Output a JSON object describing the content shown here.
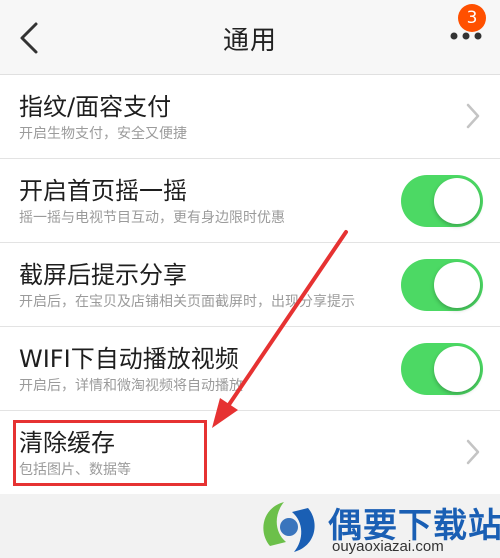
{
  "header": {
    "title": "通用",
    "back_icon": "chevron-left-icon",
    "more_icon": "more-dots-icon",
    "badge_count": "3"
  },
  "settings": [
    {
      "title": "指纹/面容支付",
      "subtitle": "开启生物支付，安全又便捷",
      "control": "chevron"
    },
    {
      "title": "开启首页摇一摇",
      "subtitle": "摇一摇与电视节目互动，更有身边限时优惠",
      "control": "toggle",
      "on": true
    },
    {
      "title": "截屏后提示分享",
      "subtitle": "开启后，在宝贝及店铺相关页面截屏时，出现分享提示",
      "control": "toggle",
      "on": true
    },
    {
      "title": "WIFI下自动播放视频",
      "subtitle": "开启后，详情和微淘视频将自动播放",
      "control": "toggle",
      "on": true
    },
    {
      "title": "清除缓存",
      "subtitle": "包括图片、数据等",
      "control": "chevron"
    }
  ],
  "colors": {
    "toggle_on": "#4cd964",
    "badge": "#ff5000",
    "annotation_red": "#e63232",
    "watermark_blue": "#1a5fb4"
  },
  "watermark": {
    "title": "偶要下载站",
    "url": "ouyaoxiazai.com"
  }
}
